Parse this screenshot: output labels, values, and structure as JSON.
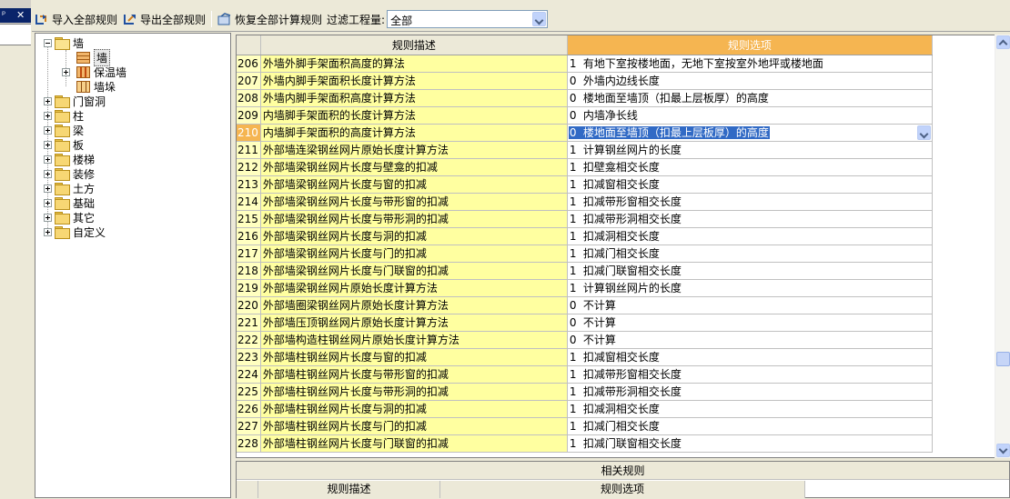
{
  "edge_panel": {
    "pin_glyph": "ᵖ",
    "close_glyph": "✕"
  },
  "toolbar": {
    "import_label": "导入全部规则",
    "export_label": "导出全部规则",
    "restore_label": "恢复全部计算规则",
    "filter_label": "过滤工程量:",
    "filter_value": "全部"
  },
  "tree": {
    "wall": "墙",
    "wall_children": [
      "墙",
      "保温墙",
      "墙垛"
    ],
    "others": [
      "门窗洞",
      "柱",
      "梁",
      "板",
      "楼梯",
      "装修",
      "土方",
      "基础",
      "其它",
      "自定义"
    ]
  },
  "grid": {
    "headers": {
      "desc": "规则描述",
      "opt": "规则选项"
    },
    "selected_row": "210",
    "rows": [
      {
        "num": "206",
        "desc": "外墙外脚手架面积高度的算法",
        "code": "1",
        "opt": "有地下室按楼地面，无地下室按室外地坪或楼地面"
      },
      {
        "num": "207",
        "desc": "外墙内脚手架面积长度计算方法",
        "code": "0",
        "opt": "外墙内边线长度"
      },
      {
        "num": "208",
        "desc": "外墙内脚手架面积高度计算方法",
        "code": "0",
        "opt": "楼地面至墙顶（扣最上层板厚）的高度"
      },
      {
        "num": "209",
        "desc": "内墙脚手架面积的长度计算方法",
        "code": "0",
        "opt": "内墙净长线"
      },
      {
        "num": "210",
        "desc": "内墙脚手架面积的高度计算方法",
        "code": "0",
        "opt": "楼地面至墙顶（扣最上层板厚）的高度"
      },
      {
        "num": "211",
        "desc": "外部墙连梁钢丝网片原始长度计算方法",
        "code": "1",
        "opt": "计算钢丝网片的长度"
      },
      {
        "num": "212",
        "desc": "外部墙梁钢丝网片长度与壁龛的扣减",
        "code": "1",
        "opt": "扣壁龛相交长度"
      },
      {
        "num": "213",
        "desc": "外部墙梁钢丝网片长度与窗的扣减",
        "code": "1",
        "opt": "扣减窗相交长度"
      },
      {
        "num": "214",
        "desc": "外部墙梁钢丝网片长度与带形窗的扣减",
        "code": "1",
        "opt": "扣减带形窗相交长度"
      },
      {
        "num": "215",
        "desc": "外部墙梁钢丝网片长度与带形洞的扣减",
        "code": "1",
        "opt": "扣减带形洞相交长度"
      },
      {
        "num": "216",
        "desc": "外部墙梁钢丝网片长度与洞的扣减",
        "code": "1",
        "opt": "扣减洞相交长度"
      },
      {
        "num": "217",
        "desc": "外部墙梁钢丝网片长度与门的扣减",
        "code": "1",
        "opt": "扣减门相交长度"
      },
      {
        "num": "218",
        "desc": "外部墙梁钢丝网片长度与门联窗的扣减",
        "code": "1",
        "opt": "扣减门联窗相交长度"
      },
      {
        "num": "219",
        "desc": "外部墙梁钢丝网片原始长度计算方法",
        "code": "1",
        "opt": "计算钢丝网片的长度"
      },
      {
        "num": "220",
        "desc": "外部墙圈梁钢丝网片原始长度计算方法",
        "code": "0",
        "opt": "不计算"
      },
      {
        "num": "221",
        "desc": "外部墙压顶钢丝网片原始长度计算方法",
        "code": "0",
        "opt": "不计算"
      },
      {
        "num": "222",
        "desc": "外部墙构造柱钢丝网片原始长度计算方法",
        "code": "0",
        "opt": "不计算"
      },
      {
        "num": "223",
        "desc": "外部墙柱钢丝网片长度与窗的扣减",
        "code": "1",
        "opt": "扣减窗相交长度"
      },
      {
        "num": "224",
        "desc": "外部墙柱钢丝网片长度与带形窗的扣减",
        "code": "1",
        "opt": "扣减带形窗相交长度"
      },
      {
        "num": "225",
        "desc": "外部墙柱钢丝网片长度与带形洞的扣减",
        "code": "1",
        "opt": "扣减带形洞相交长度"
      },
      {
        "num": "226",
        "desc": "外部墙柱钢丝网片长度与洞的扣减",
        "code": "1",
        "opt": "扣减洞相交长度"
      },
      {
        "num": "227",
        "desc": "外部墙柱钢丝网片长度与门的扣减",
        "code": "1",
        "opt": "扣减门相交长度"
      },
      {
        "num": "228",
        "desc": "外部墙柱钢丝网片长度与门联窗的扣减",
        "code": "1",
        "opt": "扣减门联窗相交长度"
      }
    ]
  },
  "related": {
    "title": "相关规则",
    "headers": {
      "desc": "规则描述",
      "opt": "规则选项"
    }
  },
  "colors": {
    "header_accent": "#f5b551",
    "desc_bg": "#ffffa0",
    "selection": "#316ac5"
  }
}
